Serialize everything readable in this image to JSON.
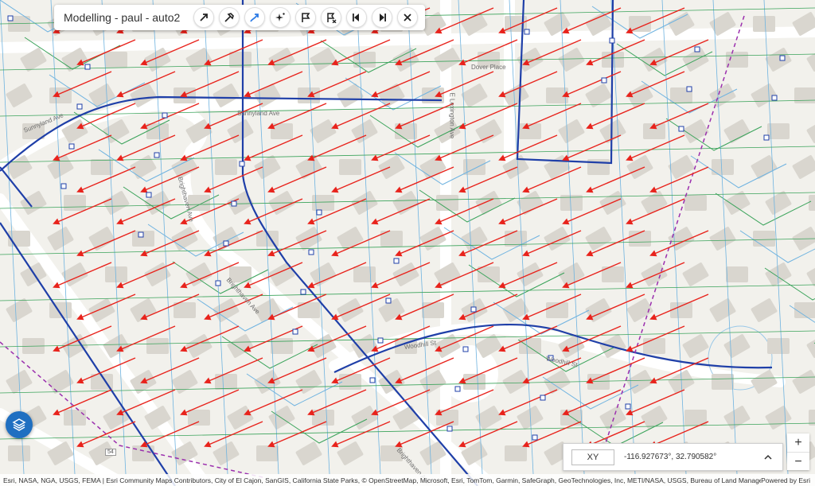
{
  "toolbar": {
    "title": "Modelling - paul - auto2",
    "tools": [
      {
        "name": "select-arrow-icon"
      },
      {
        "name": "hammer-tool-icon"
      },
      {
        "name": "route-arrow-icon"
      },
      {
        "name": "sparkle-magic-icon"
      },
      {
        "name": "flag-icon"
      },
      {
        "name": "flag-remove-icon"
      },
      {
        "name": "step-back-icon"
      },
      {
        "name": "step-forward-icon"
      },
      {
        "name": "close-icon"
      }
    ]
  },
  "streets": {
    "sunnyland_1": "Sunnyland Ave",
    "sunnyland_2": "Sunnyland Ave",
    "brighthaven_1": "Brighthaven Ave",
    "brighthaven_2": "Brighthaven Ave",
    "brighthaven_3": "Brighthaven Ave",
    "lexington": "E Lexington Ave",
    "dover": "Dover Place",
    "woodhill_1": "Woodhill St",
    "woodhill_2": "Woodhill St",
    "route": "54"
  },
  "coordinates": {
    "mode_label": "XY",
    "value": "-116.927673°, 32.790582°"
  },
  "zoom": {
    "in": "+",
    "out": "−"
  },
  "attribution": {
    "text": "Esri, NASA, NGA, USGS, FEMA | Esri Community Maps Contributors, City of El Cajon, SanGIS, California State Parks, © OpenStreetMap, Microsoft, Esri, TomTom, Garmin, SafeGraph, GeoTechnologies, Inc, METI/NASA, USGS, Bureau of Land Manage...",
    "powered": "Powered by Esri"
  },
  "colors": {
    "flow_arrow": "#e8231c",
    "main_line": "#1f3fa8",
    "parcel_green": "#3aa35a",
    "parcel_blue": "#6fb3e0",
    "boundary_purple": "#9b2fae",
    "building": "#d9d6cf",
    "road": "#ffffff"
  }
}
